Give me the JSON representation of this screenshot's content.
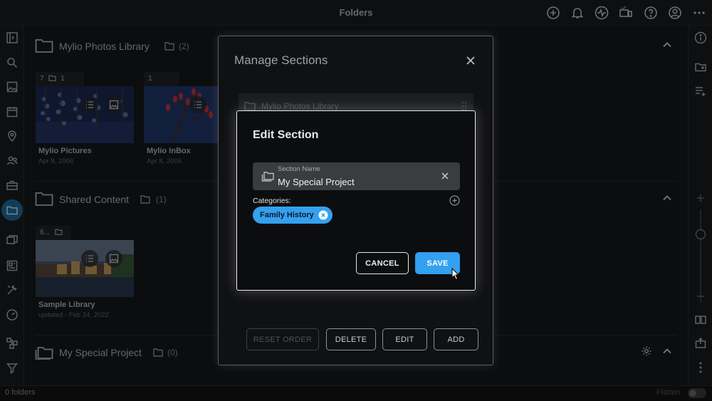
{
  "window": {
    "title": "Folders"
  },
  "sections": [
    {
      "name": "Mylio Photos Library",
      "count": "(2)",
      "tiles": [
        {
          "badge": "7",
          "folders": "1",
          "name": "Mylio Pictures",
          "date": "Apr 8, 2006"
        },
        {
          "badge": "1",
          "folders": "",
          "name": "Mylio InBox",
          "date": "Apr 8, 2006"
        }
      ]
    },
    {
      "name": "Shared Content",
      "count": "(1)",
      "tiles": [
        {
          "badge": "6...",
          "folders": "",
          "name": "Sample Library",
          "date": "updated - Feb 24, 2022"
        }
      ]
    },
    {
      "name": "My Special Project",
      "count": "(0)",
      "tiles": []
    }
  ],
  "status": {
    "count": "0 folders",
    "flatten": "Flatten"
  },
  "manage_dialog": {
    "title": "Manage Sections",
    "row_label": "Mylio Photos Library",
    "buttons": {
      "reset": "RESET ORDER",
      "delete": "DELETE",
      "edit": "EDIT",
      "add": "ADD"
    }
  },
  "edit_dialog": {
    "title": "Edit Section",
    "field_label": "Section Name",
    "field_value": "My Special Project",
    "categories_label": "Categories:",
    "chips": [
      "Family History"
    ],
    "buttons": {
      "cancel": "CANCEL",
      "save": "SAVE"
    }
  },
  "colors": {
    "accent": "#34a0f0",
    "active_nav": "#1f6fa8",
    "background": "#17181a"
  },
  "icons": {
    "top": [
      "add-circle-icon",
      "bell-icon",
      "activity-icon",
      "devices-icon",
      "help-icon",
      "account-icon",
      "more-icon"
    ],
    "left": [
      "panel-icon",
      "search-icon",
      "photo-icon",
      "calendar-icon",
      "map-pin-icon",
      "people-icon",
      "camera-icon",
      "folder-icon",
      "albums-icon",
      "document-icon",
      "tools-icon",
      "dashboard-icon",
      "sources-icon",
      "filter-icon"
    ],
    "right": [
      "info-icon",
      "add-folder-icon",
      "list-add-icon",
      "zoom-in-icon",
      "zoom-out-icon",
      "book-icon",
      "export-icon",
      "more-vertical-icon"
    ]
  }
}
